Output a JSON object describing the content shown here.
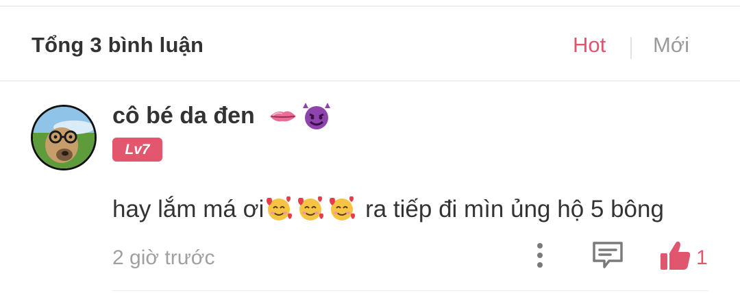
{
  "comments_header": {
    "title": "Tổng 3 bình luận",
    "tabs": [
      {
        "label": "Hot",
        "active": true
      },
      {
        "label": "Mới",
        "active": false
      }
    ]
  },
  "comment": {
    "username": "cô bé da đen",
    "username_emojis": [
      "lips-emoji",
      "smiling-devil-emoji"
    ],
    "level": "Lv7",
    "text_before": "hay lắm má ơi",
    "text_emojis": [
      "smiling-face-with-hearts-emoji",
      "smiling-face-with-hearts-emoji",
      "smiling-face-with-hearts-emoji"
    ],
    "text_after": " ra tiếp đi mìn ủng hộ 5 bông",
    "time": "2 giờ trước",
    "like_count": "1"
  },
  "colors": {
    "accent": "#e0566f",
    "text": "#333333",
    "muted": "#a0a0a0"
  }
}
